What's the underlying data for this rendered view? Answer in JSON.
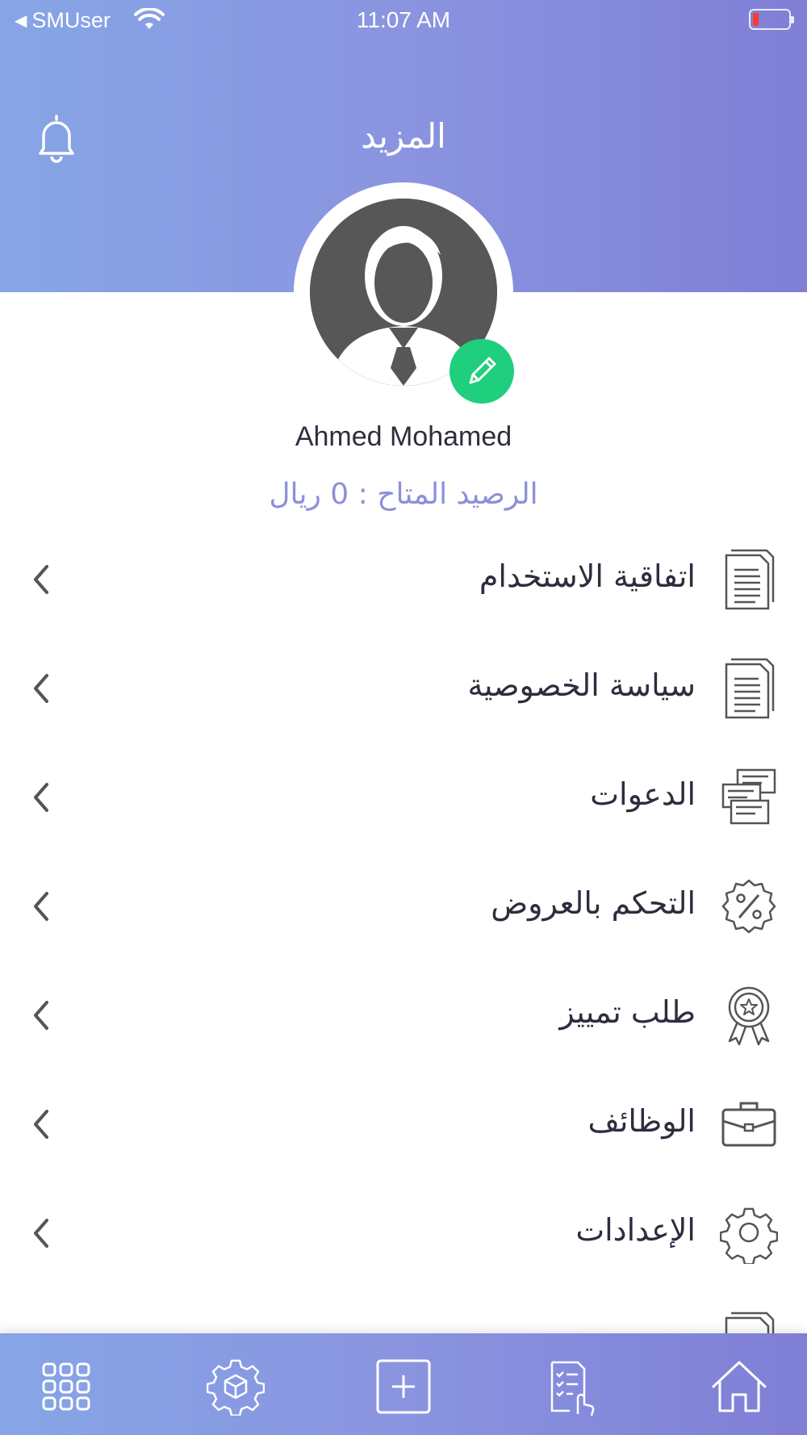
{
  "status_bar": {
    "carrier": "SMUser",
    "time": "11:07 AM",
    "battery_color": "#ff3b30"
  },
  "header": {
    "title": "المزيد",
    "bell_icon": "bell-icon"
  },
  "profile": {
    "name": "Ahmed Mohamed",
    "balance": "الرصيد المتاح : 0 ريال",
    "edit_icon": "pencil-icon",
    "edit_color": "#1fcf7e"
  },
  "menu": {
    "items": [
      {
        "label": "اتفاقية الاستخدام",
        "icon": "document-icon"
      },
      {
        "label": "سياسة الخصوصية",
        "icon": "document-icon"
      },
      {
        "label": "الدعوات",
        "icon": "invitations-icon"
      },
      {
        "label": "التحكم بالعروض",
        "icon": "percent-badge-icon"
      },
      {
        "label": "طلب تمييز",
        "icon": "award-ribbon-icon"
      },
      {
        "label": "الوظائف",
        "icon": "briefcase-icon"
      },
      {
        "label": "الإعدادات",
        "icon": "gear-icon"
      }
    ]
  },
  "tabbar": {
    "tabs": [
      {
        "icon": "grid-icon"
      },
      {
        "icon": "gear-box-icon"
      },
      {
        "icon": "add-square-icon"
      },
      {
        "icon": "checklist-hand-icon"
      },
      {
        "icon": "home-icon"
      }
    ]
  },
  "colors": {
    "header_gradient_start": "#86a5e6",
    "header_gradient_end": "#7f7fd6",
    "balance_text": "#8d8fd8"
  }
}
